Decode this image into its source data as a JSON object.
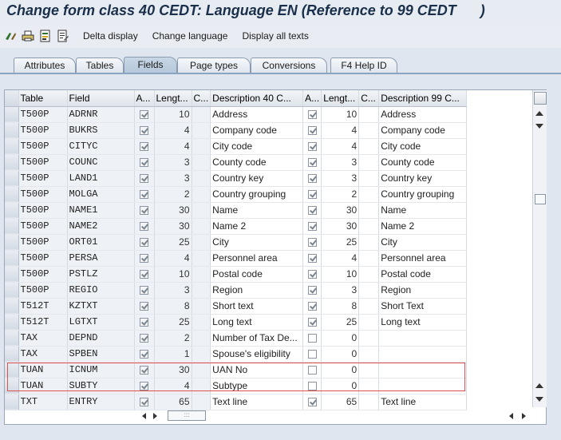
{
  "window": {
    "title": "Change form class 40 CEDT: Language EN (Reference to 99 CEDT      )"
  },
  "toolbar": {
    "icons": [
      "glasses-icon",
      "printer-icon",
      "document-list-icon",
      "document-edit-icon"
    ],
    "buttons": [
      "Delta display",
      "Change language",
      "Display all texts"
    ]
  },
  "tabs": [
    {
      "label": "Attributes"
    },
    {
      "label": "Tables"
    },
    {
      "label": "Fields",
      "active": true
    },
    {
      "label": "Page types"
    },
    {
      "label": "Conversions"
    },
    {
      "label": "F4 Help ID"
    }
  ],
  "table": {
    "headers": [
      "Table",
      "Field",
      "A...",
      "Lengt...",
      "C...",
      "Description 40 C...",
      "A...",
      "Lengt...",
      "C...",
      "Description 99 C..."
    ],
    "rows": [
      {
        "table": "T500P",
        "field": "ADRNR",
        "a1": true,
        "len1": "10",
        "desc1": "Address",
        "a2": true,
        "len2": "10",
        "desc2": "Address"
      },
      {
        "table": "T500P",
        "field": "BUKRS",
        "a1": true,
        "len1": "4",
        "desc1": "Company code",
        "a2": true,
        "len2": "4",
        "desc2": "Company code"
      },
      {
        "table": "T500P",
        "field": "CITYC",
        "a1": true,
        "len1": "4",
        "desc1": "City code",
        "a2": true,
        "len2": "4",
        "desc2": "City code"
      },
      {
        "table": "T500P",
        "field": "COUNC",
        "a1": true,
        "len1": "3",
        "desc1": "County code",
        "a2": true,
        "len2": "3",
        "desc2": "County code"
      },
      {
        "table": "T500P",
        "field": "LAND1",
        "a1": true,
        "len1": "3",
        "desc1": "Country key",
        "a2": true,
        "len2": "3",
        "desc2": "Country key"
      },
      {
        "table": "T500P",
        "field": "MOLGA",
        "a1": true,
        "len1": "2",
        "desc1": "Country grouping",
        "a2": true,
        "len2": "2",
        "desc2": "Country grouping"
      },
      {
        "table": "T500P",
        "field": "NAME1",
        "a1": true,
        "len1": "30",
        "desc1": "Name",
        "a2": true,
        "len2": "30",
        "desc2": "Name"
      },
      {
        "table": "T500P",
        "field": "NAME2",
        "a1": true,
        "len1": "30",
        "desc1": "Name 2",
        "a2": true,
        "len2": "30",
        "desc2": "Name 2"
      },
      {
        "table": "T500P",
        "field": "ORT01",
        "a1": true,
        "len1": "25",
        "desc1": "City",
        "a2": true,
        "len2": "25",
        "desc2": "City"
      },
      {
        "table": "T500P",
        "field": "PERSA",
        "a1": true,
        "len1": "4",
        "desc1": "Personnel area",
        "a2": true,
        "len2": "4",
        "desc2": "Personnel area"
      },
      {
        "table": "T500P",
        "field": "PSTLZ",
        "a1": true,
        "len1": "10",
        "desc1": "Postal code",
        "a2": true,
        "len2": "10",
        "desc2": "Postal code"
      },
      {
        "table": "T500P",
        "field": "REGIO",
        "a1": true,
        "len1": "3",
        "desc1": "Region",
        "a2": true,
        "len2": "3",
        "desc2": "Region"
      },
      {
        "table": "T512T",
        "field": "KZTXT",
        "a1": true,
        "len1": "8",
        "desc1": "Short text",
        "a2": true,
        "len2": "8",
        "desc2": "Short Text"
      },
      {
        "table": "T512T",
        "field": "LGTXT",
        "a1": true,
        "len1": "25",
        "desc1": "Long text",
        "a2": true,
        "len2": "25",
        "desc2": "Long text"
      },
      {
        "table": "TAX",
        "field": "DEPND",
        "a1": true,
        "len1": "2",
        "desc1": "Number of Tax De...",
        "a2": false,
        "len2": "0",
        "desc2": ""
      },
      {
        "table": "TAX",
        "field": "SPBEN",
        "a1": true,
        "len1": "1",
        "desc1": "Spouse's eligibility",
        "a2": false,
        "len2": "0",
        "desc2": ""
      },
      {
        "table": "TUAN",
        "field": "ICNUM",
        "a1": true,
        "len1": "30",
        "desc1": "UAN No",
        "a2": false,
        "len2": "0",
        "desc2": ""
      },
      {
        "table": "TUAN",
        "field": "SUBTY",
        "a1": true,
        "len1": "4",
        "desc1": "Subtype",
        "a2": false,
        "len2": "0",
        "desc2": ""
      },
      {
        "table": "TXT",
        "field": "ENTRY",
        "a1": true,
        "len1": "65",
        "desc1": "Text line",
        "a2": true,
        "len2": "65",
        "desc2": "Text line"
      }
    ]
  },
  "colors": {
    "highlight_border": "#e05050",
    "title_text": "#1a2f4a"
  }
}
